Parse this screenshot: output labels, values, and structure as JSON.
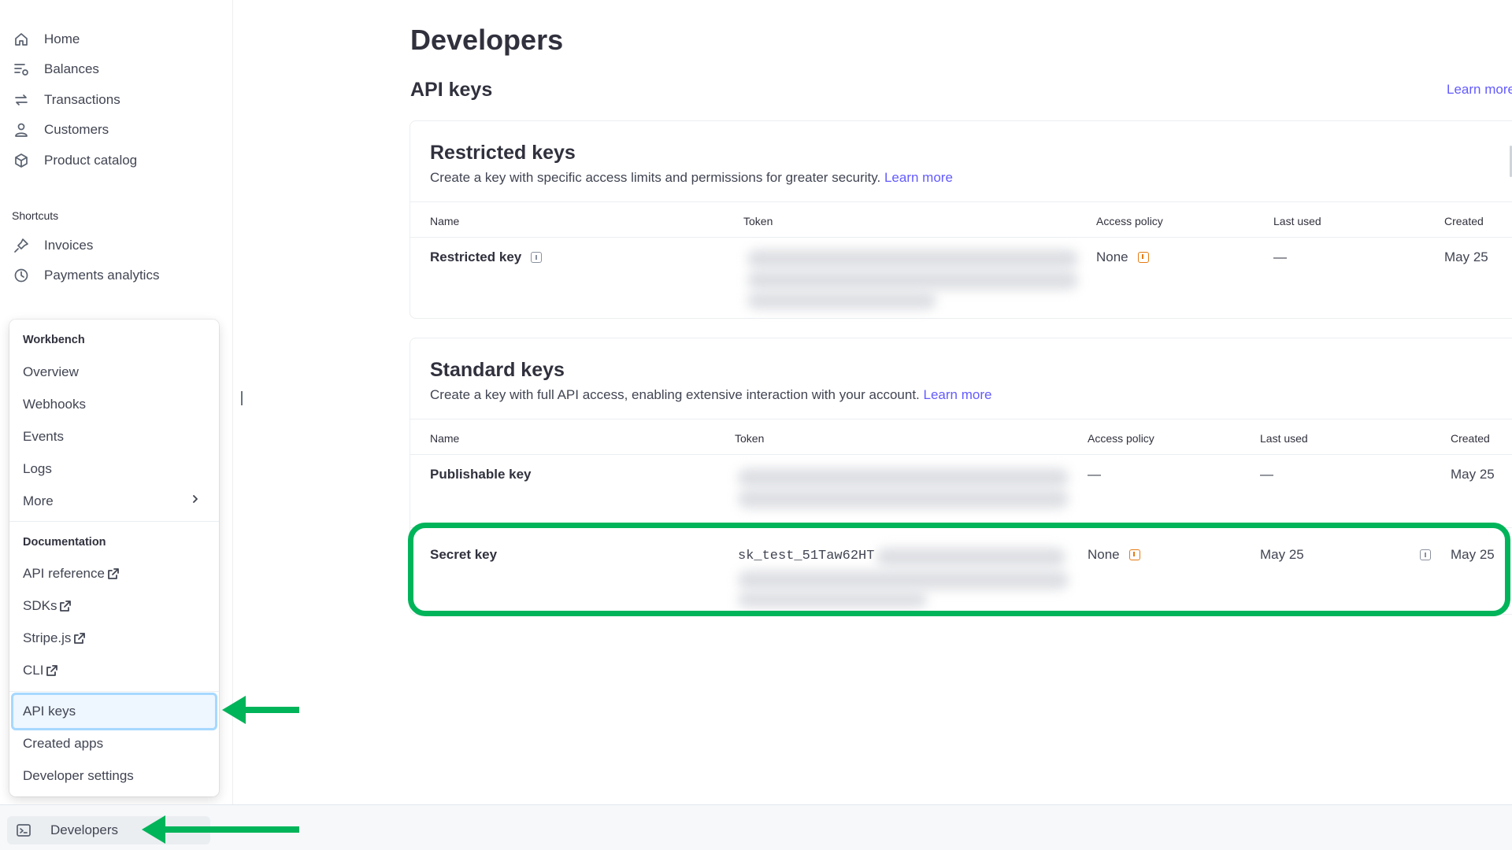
{
  "sidebar": {
    "primary": [
      {
        "label": "Home",
        "icon": "home-icon"
      },
      {
        "label": "Balances",
        "icon": "balances-icon"
      },
      {
        "label": "Transactions",
        "icon": "transactions-icon"
      },
      {
        "label": "Customers",
        "icon": "customer-icon"
      },
      {
        "label": "Product catalog",
        "icon": "box-icon"
      }
    ],
    "shortcuts_label": "Shortcuts",
    "shortcuts": [
      {
        "label": "Invoices",
        "icon": "pin-icon"
      },
      {
        "label": "Payments analytics",
        "icon": "clock-icon"
      }
    ]
  },
  "popup": {
    "workbench_title": "Workbench",
    "workbench_items": [
      "Overview",
      "Webhooks",
      "Events",
      "Logs",
      "More"
    ],
    "documentation_title": "Documentation",
    "documentation_items": [
      "API reference",
      "SDKs",
      "Stripe.js",
      "CLI"
    ],
    "bottom_items": [
      "API keys",
      "Created apps",
      "Developer settings"
    ],
    "active_item": "API keys"
  },
  "bottom_bar": {
    "developers_label": "Developers",
    "icon": "terminal-icon"
  },
  "main": {
    "page_title": "Developers",
    "section_title": "API keys",
    "learn_more_top": "Learn more",
    "restricted": {
      "title": "Restricted keys",
      "description": "Create a key with specific access limits and permissions for greater security.",
      "learn_more": "Learn more",
      "columns": [
        "Name",
        "Token",
        "Access policy",
        "Last used",
        "Created"
      ],
      "rows": [
        {
          "name": "Restricted key",
          "token": "",
          "access_policy": "None",
          "last_used": "—",
          "created": "May 25"
        }
      ]
    },
    "standard": {
      "title": "Standard keys",
      "description": "Create a key with full API access, enabling extensive interaction with your account.",
      "learn_more": "Learn more",
      "columns": [
        "Name",
        "Token",
        "Access policy",
        "Last used",
        "Created"
      ],
      "rows": [
        {
          "name": "Publishable key",
          "token": "",
          "access_policy": "—",
          "last_used": "—",
          "created": "May 25"
        },
        {
          "name": "Secret key",
          "token": "sk_test_51Taw62HT",
          "access_policy": "None",
          "last_used": "May 25",
          "created": "May 25"
        }
      ]
    }
  },
  "colors": {
    "accent": "#635bff",
    "annotation": "#00b45a",
    "warning": "#e57b12",
    "active_border": "#a6d8ff"
  }
}
